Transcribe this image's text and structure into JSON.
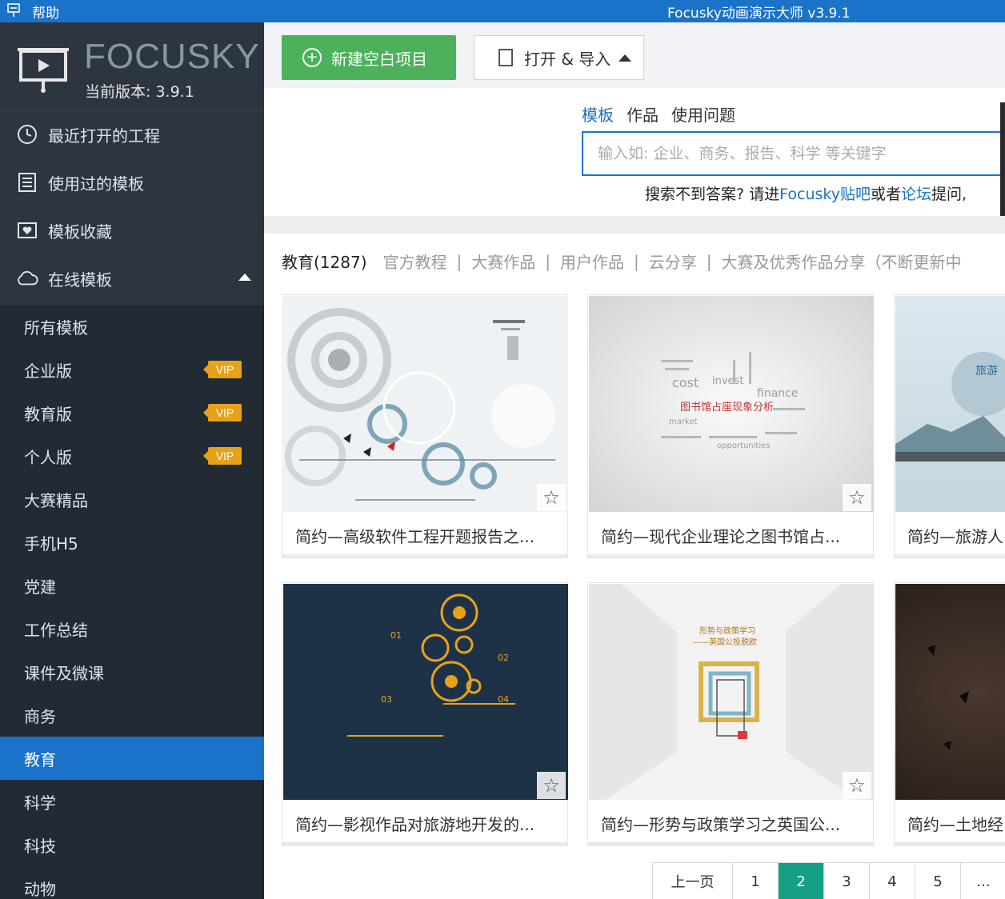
{
  "titlebar": {
    "help_label": "帮助",
    "app_title": "Focusky动画演示大师 v3.9.1"
  },
  "sidebar": {
    "logo_text": "FOCUSKY",
    "version_label": "当前版本: 3.9.1",
    "top_items": [
      {
        "label": "最近打开的工程",
        "icon": "clock-icon"
      },
      {
        "label": "使用过的模板",
        "icon": "template-list-icon"
      },
      {
        "label": "模板收藏",
        "icon": "heart-folder-icon"
      },
      {
        "label": "在线模板",
        "icon": "cloud-icon"
      }
    ],
    "sub_items": [
      {
        "label": "所有模板",
        "vip": ""
      },
      {
        "label": "企业版",
        "vip": "VIP"
      },
      {
        "label": "教育版",
        "vip": "VIP"
      },
      {
        "label": "个人版",
        "vip": "VIP"
      },
      {
        "label": "大赛精品",
        "vip": ""
      },
      {
        "label": "手机H5",
        "vip": ""
      },
      {
        "label": "党建",
        "vip": ""
      },
      {
        "label": "工作总结",
        "vip": ""
      },
      {
        "label": "课件及微课",
        "vip": ""
      },
      {
        "label": "商务",
        "vip": ""
      },
      {
        "label": "教育",
        "vip": ""
      },
      {
        "label": "科学",
        "vip": ""
      },
      {
        "label": "科技",
        "vip": ""
      },
      {
        "label": "动物",
        "vip": ""
      }
    ],
    "active_sub": "教育"
  },
  "toolbar": {
    "new_label": "新建空白项目",
    "open_label": "打开 & 导入"
  },
  "search": {
    "tabs": [
      "模板",
      "作品",
      "使用问题"
    ],
    "active_tab": "模板",
    "placeholder": "输入如: 企业、商务、报告、科学 等关键字",
    "hint_prefix": "搜索不到答案? 请进",
    "hint_link1": "Focusky贴吧",
    "hint_mid": "或者",
    "hint_link2": "论坛",
    "hint_suffix": "提问,"
  },
  "filter": {
    "current": "教育(1287)",
    "links": [
      "官方教程",
      "大赛作品",
      "用户作品",
      "云分享",
      "大赛及优秀作品分享（不断更新中"
    ]
  },
  "cards": [
    {
      "title": "简约—高级软件工程开题报告之..."
    },
    {
      "title": "简约—现代企业理论之图书馆占..."
    },
    {
      "title": "简约—旅游人"
    },
    {
      "title": "简约—影视作品对旅游地开发的..."
    },
    {
      "title": "简约—形势与政策学习之英国公..."
    },
    {
      "title": "简约—土地经"
    }
  ],
  "thumb_text": {
    "c2_words": [
      "cost",
      "invest",
      "finance",
      "opportunities",
      "market"
    ],
    "c2_title": "图书馆占座现象分析",
    "c3_text": "旅游",
    "c4_labels": [
      "01",
      "02",
      "03",
      "04"
    ],
    "c5_title1": "形势与政策学习",
    "c5_title2": "——英国公投脱欧"
  },
  "pager": {
    "prev": "上一页",
    "pages": [
      "1",
      "2",
      "3",
      "4",
      "5",
      "..."
    ],
    "active": "2"
  },
  "colors": {
    "accent": "#1a73c8",
    "green": "#4db05a",
    "vip": "#e8a21a",
    "pager_active": "#15a085",
    "sidebar": "#2c3540"
  }
}
